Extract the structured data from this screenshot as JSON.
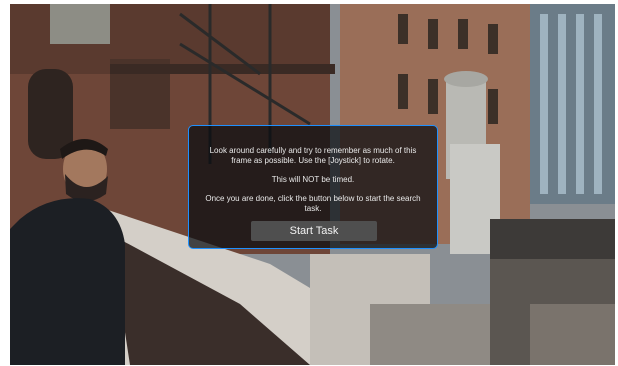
{
  "panel": {
    "instruction_line1": "Look around carefully and try to remember as much of this frame as possible. Use the [Joystick] to rotate.",
    "instruction_line2": "This will NOT be timed.",
    "instruction_line3": "Once you are done, click the button below to start the search task.",
    "start_button_label": "Start Task",
    "border_color": "#1e90ff"
  }
}
